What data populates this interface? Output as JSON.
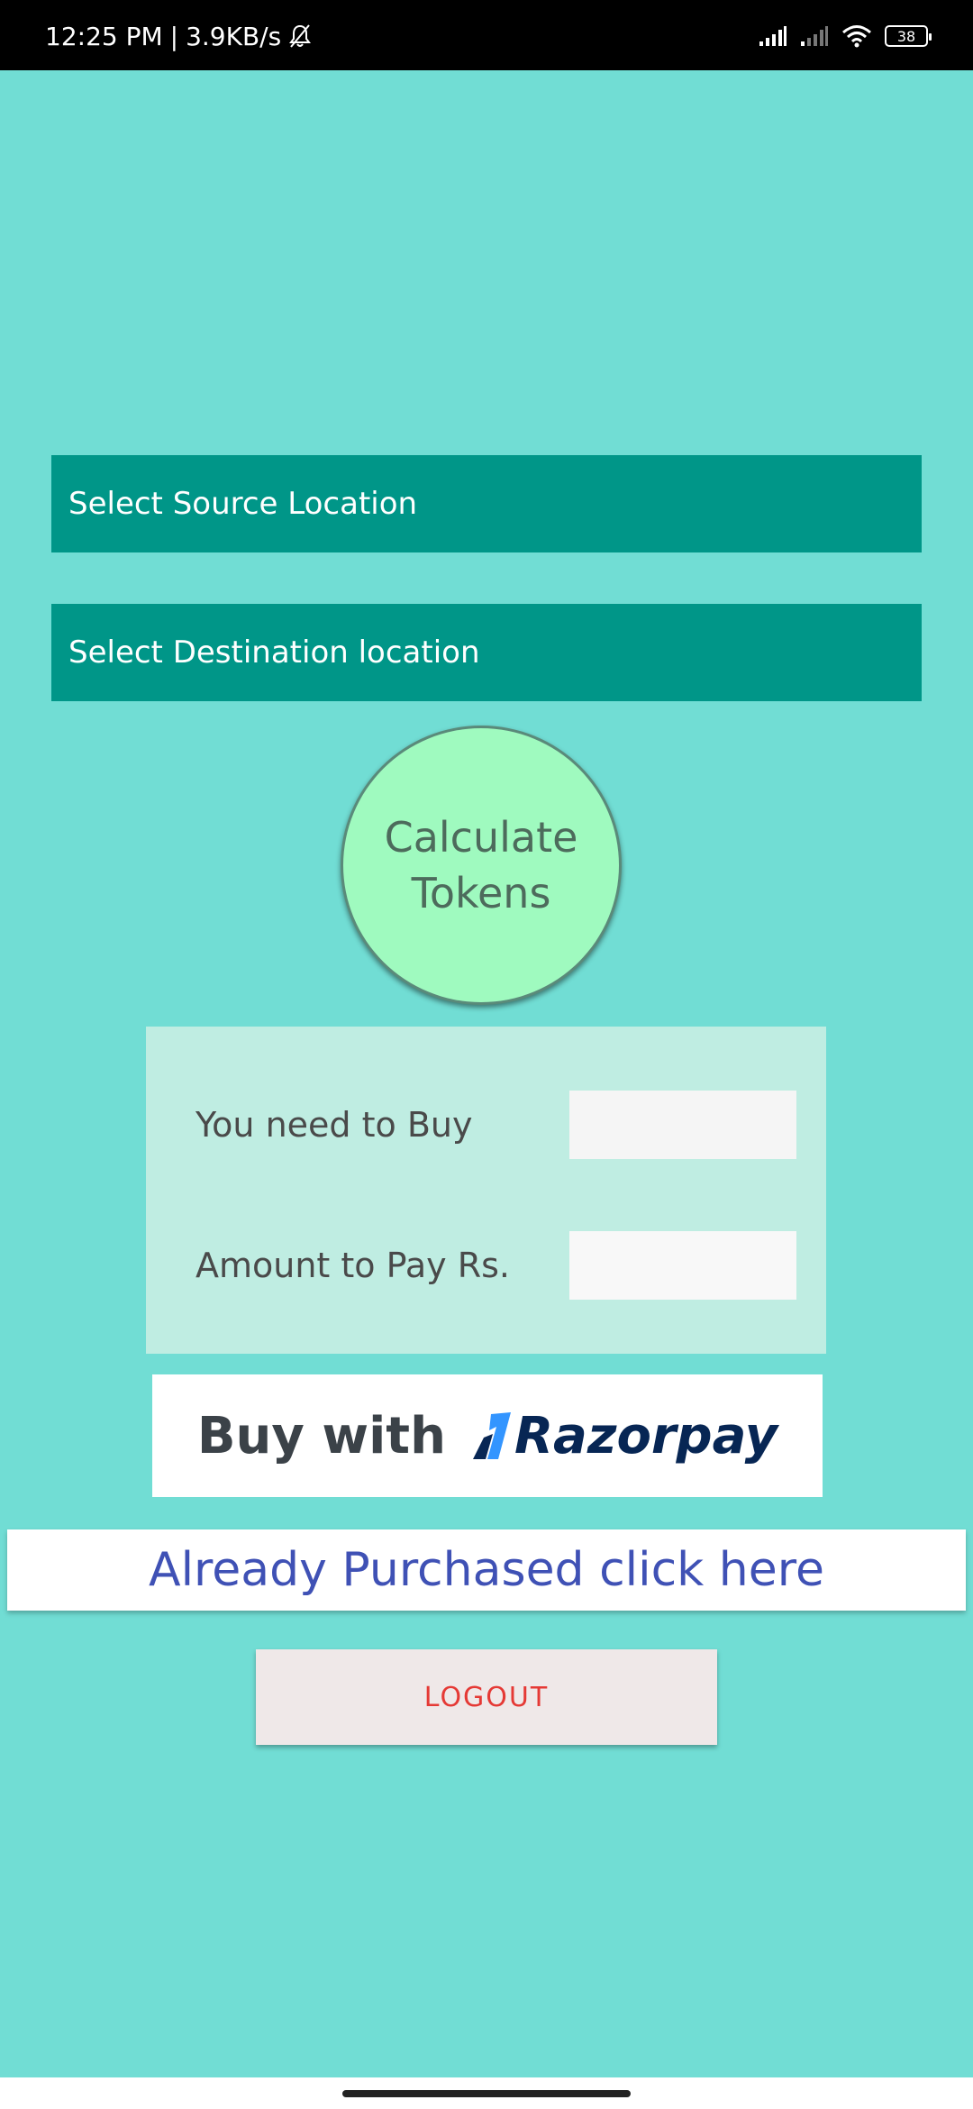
{
  "status_bar": {
    "time": "12:25 PM",
    "separator": "|",
    "network_speed": "3.9KB/s",
    "battery_level": "38",
    "icons": [
      "bell-off-icon",
      "signal-icon",
      "signal-icon",
      "wifi-icon",
      "battery-icon"
    ]
  },
  "locations": {
    "source_placeholder": "Select Source Location",
    "destination_placeholder": "Select Destination location"
  },
  "calculate": {
    "line1": "Calculate",
    "line2": "Tokens"
  },
  "result": {
    "tokens_label": "You need to Buy",
    "tokens_value": "",
    "amount_label": "Amount to Pay Rs.",
    "amount_value": ""
  },
  "razorpay": {
    "buy_text": "Buy with",
    "brand_text": "Razorpay",
    "logo_icon": "razorpay-logo-icon"
  },
  "purchased": {
    "label": "Already Purchased click here"
  },
  "logout": {
    "label": "LOGOUT"
  },
  "colors": {
    "background": "#71ddd4",
    "location_bar": "#009688",
    "calc_circle": "#9ffabf",
    "result_card": "#bfede2",
    "purchased_text": "#3f51b5",
    "logout_text": "#e53935",
    "razorpay_brand": "#072654"
  }
}
